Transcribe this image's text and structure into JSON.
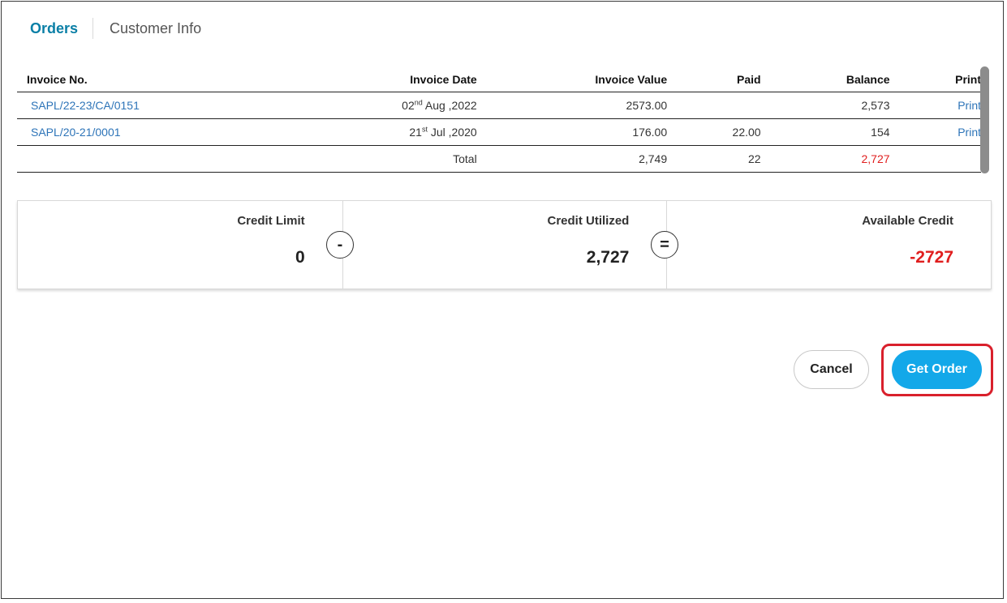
{
  "tabs": [
    {
      "label": "Orders",
      "active": true
    },
    {
      "label": "Customer Info",
      "active": false
    }
  ],
  "table": {
    "headers": [
      "Invoice No.",
      "Invoice Date",
      "Invoice Value",
      "Paid",
      "Balance",
      "Print"
    ],
    "rows": [
      {
        "invoice_no": "SAPL/22-23/CA/0151",
        "date_day": "02",
        "date_suffix": "nd",
        "date_rest": " Aug ,2022",
        "value": "2573.00",
        "paid": "",
        "balance": "2,573",
        "print": "Print"
      },
      {
        "invoice_no": "SAPL/20-21/0001",
        "date_day": "21",
        "date_suffix": "st",
        "date_rest": " Jul ,2020",
        "value": "176.00",
        "paid": "22.00",
        "balance": "154",
        "print": "Print"
      }
    ],
    "total": {
      "label": "Total",
      "value": "2,749",
      "paid": "22",
      "balance": "2,727"
    }
  },
  "credit": {
    "limit_label": "Credit Limit",
    "limit_value": "0",
    "minus_op": "-",
    "utilized_label": "Credit Utilized",
    "utilized_value": "2,727",
    "equals_op": "=",
    "available_label": "Available Credit",
    "available_value": "-2727"
  },
  "buttons": {
    "cancel": "Cancel",
    "get_order": "Get Order"
  },
  "colors": {
    "accent": "#13a8e9",
    "tab_active": "#0a7fa6",
    "link": "#2d74b8",
    "negative": "#e01e1e",
    "highlight": "#d9202c"
  }
}
